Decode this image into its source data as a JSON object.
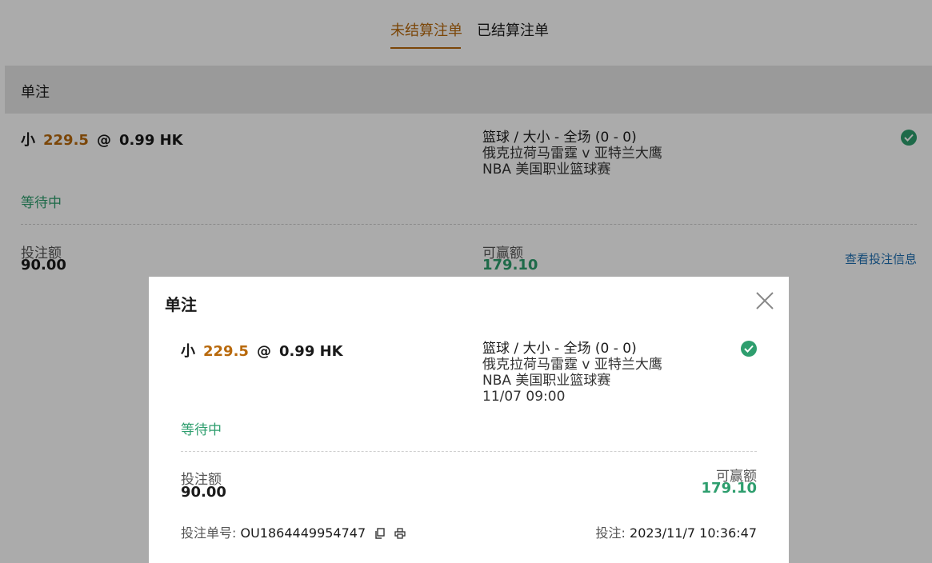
{
  "tabs": {
    "unsettled": "未结算注单",
    "settled": "已结算注单"
  },
  "section": {
    "title": "单注"
  },
  "bet": {
    "selection": "小",
    "line": "229.5",
    "at": "@",
    "odds": "0.99 HK",
    "market": "篮球 / 大小 - 全场 (0 - 0)",
    "teams": "俄克拉荷马雷霆 v 亚特兰大鹰",
    "league": "NBA 美国职业篮球赛",
    "kickoff": "11/07 09:00",
    "status": "等待中",
    "stake_label": "投注额",
    "stake": "90.00",
    "win_label": "可赢额",
    "win": "179.10",
    "view_info": "查看投注信息",
    "slip_label": "投注单号:",
    "slip_no": "OU1864449954747",
    "time_label": "投注:",
    "time": "2023/11/7 10:36:47"
  },
  "modal": {
    "title": "单注"
  },
  "icons": {
    "check": "check-circle-icon",
    "close": "close-icon",
    "copy": "copy-icon",
    "print": "print-icon"
  },
  "colors": {
    "accent": "#b8690c",
    "green": "#2e9e6e",
    "link": "#1f6fb2"
  }
}
